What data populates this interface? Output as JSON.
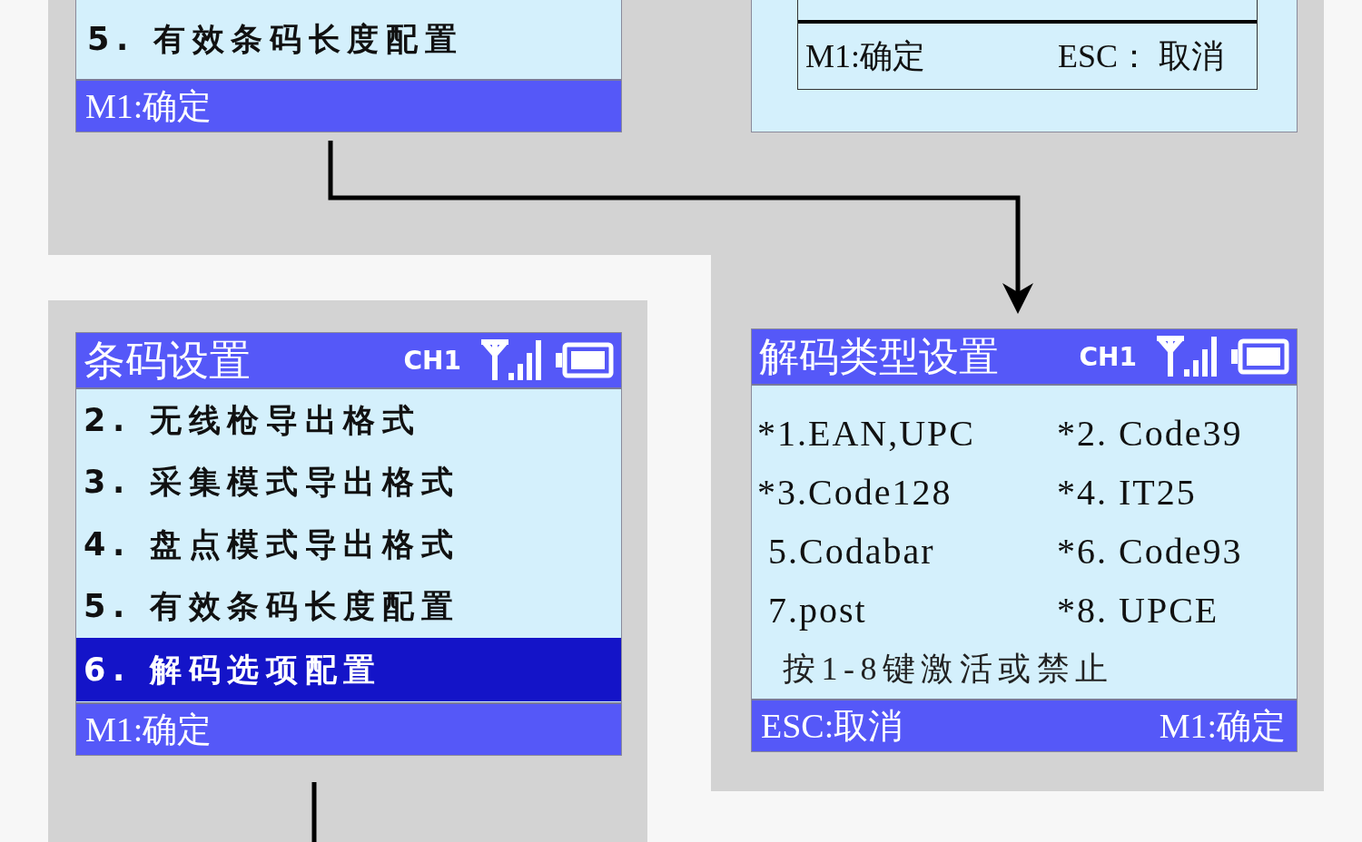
{
  "top_left_screen": {
    "rows": [
      {
        "label": "5. 有效条码长度配置",
        "selected": false
      }
    ],
    "footer": "M1:确定"
  },
  "top_right_screen": {
    "dialog": {
      "confirm": "M1:确定",
      "cancel": "ESC： 取消"
    }
  },
  "barcode_settings_screen": {
    "title": "条码设置",
    "channel": "CH1",
    "rows": [
      {
        "label": "2. 无线枪导出格式",
        "selected": false
      },
      {
        "label": "3. 采集模式导出格式",
        "selected": false
      },
      {
        "label": "4. 盘点模式导出格式",
        "selected": false
      },
      {
        "label": "5. 有效条码长度配置",
        "selected": false
      },
      {
        "label": "6. 解码选项配置",
        "selected": true
      }
    ],
    "footer": "M1:确定"
  },
  "decode_type_screen": {
    "title": "解码类型设置",
    "channel": "CH1",
    "items": [
      "*1.EAN,UPC",
      "*2. Code39",
      "*3.Code128",
      "*4. IT25",
      " 5.Codabar",
      "*6. Code93",
      " 7.post",
      "*8. UPCE"
    ],
    "hint": "按1-8键激活或禁止",
    "footer_left": "ESC:取消",
    "footer_right": "M1:确定"
  }
}
